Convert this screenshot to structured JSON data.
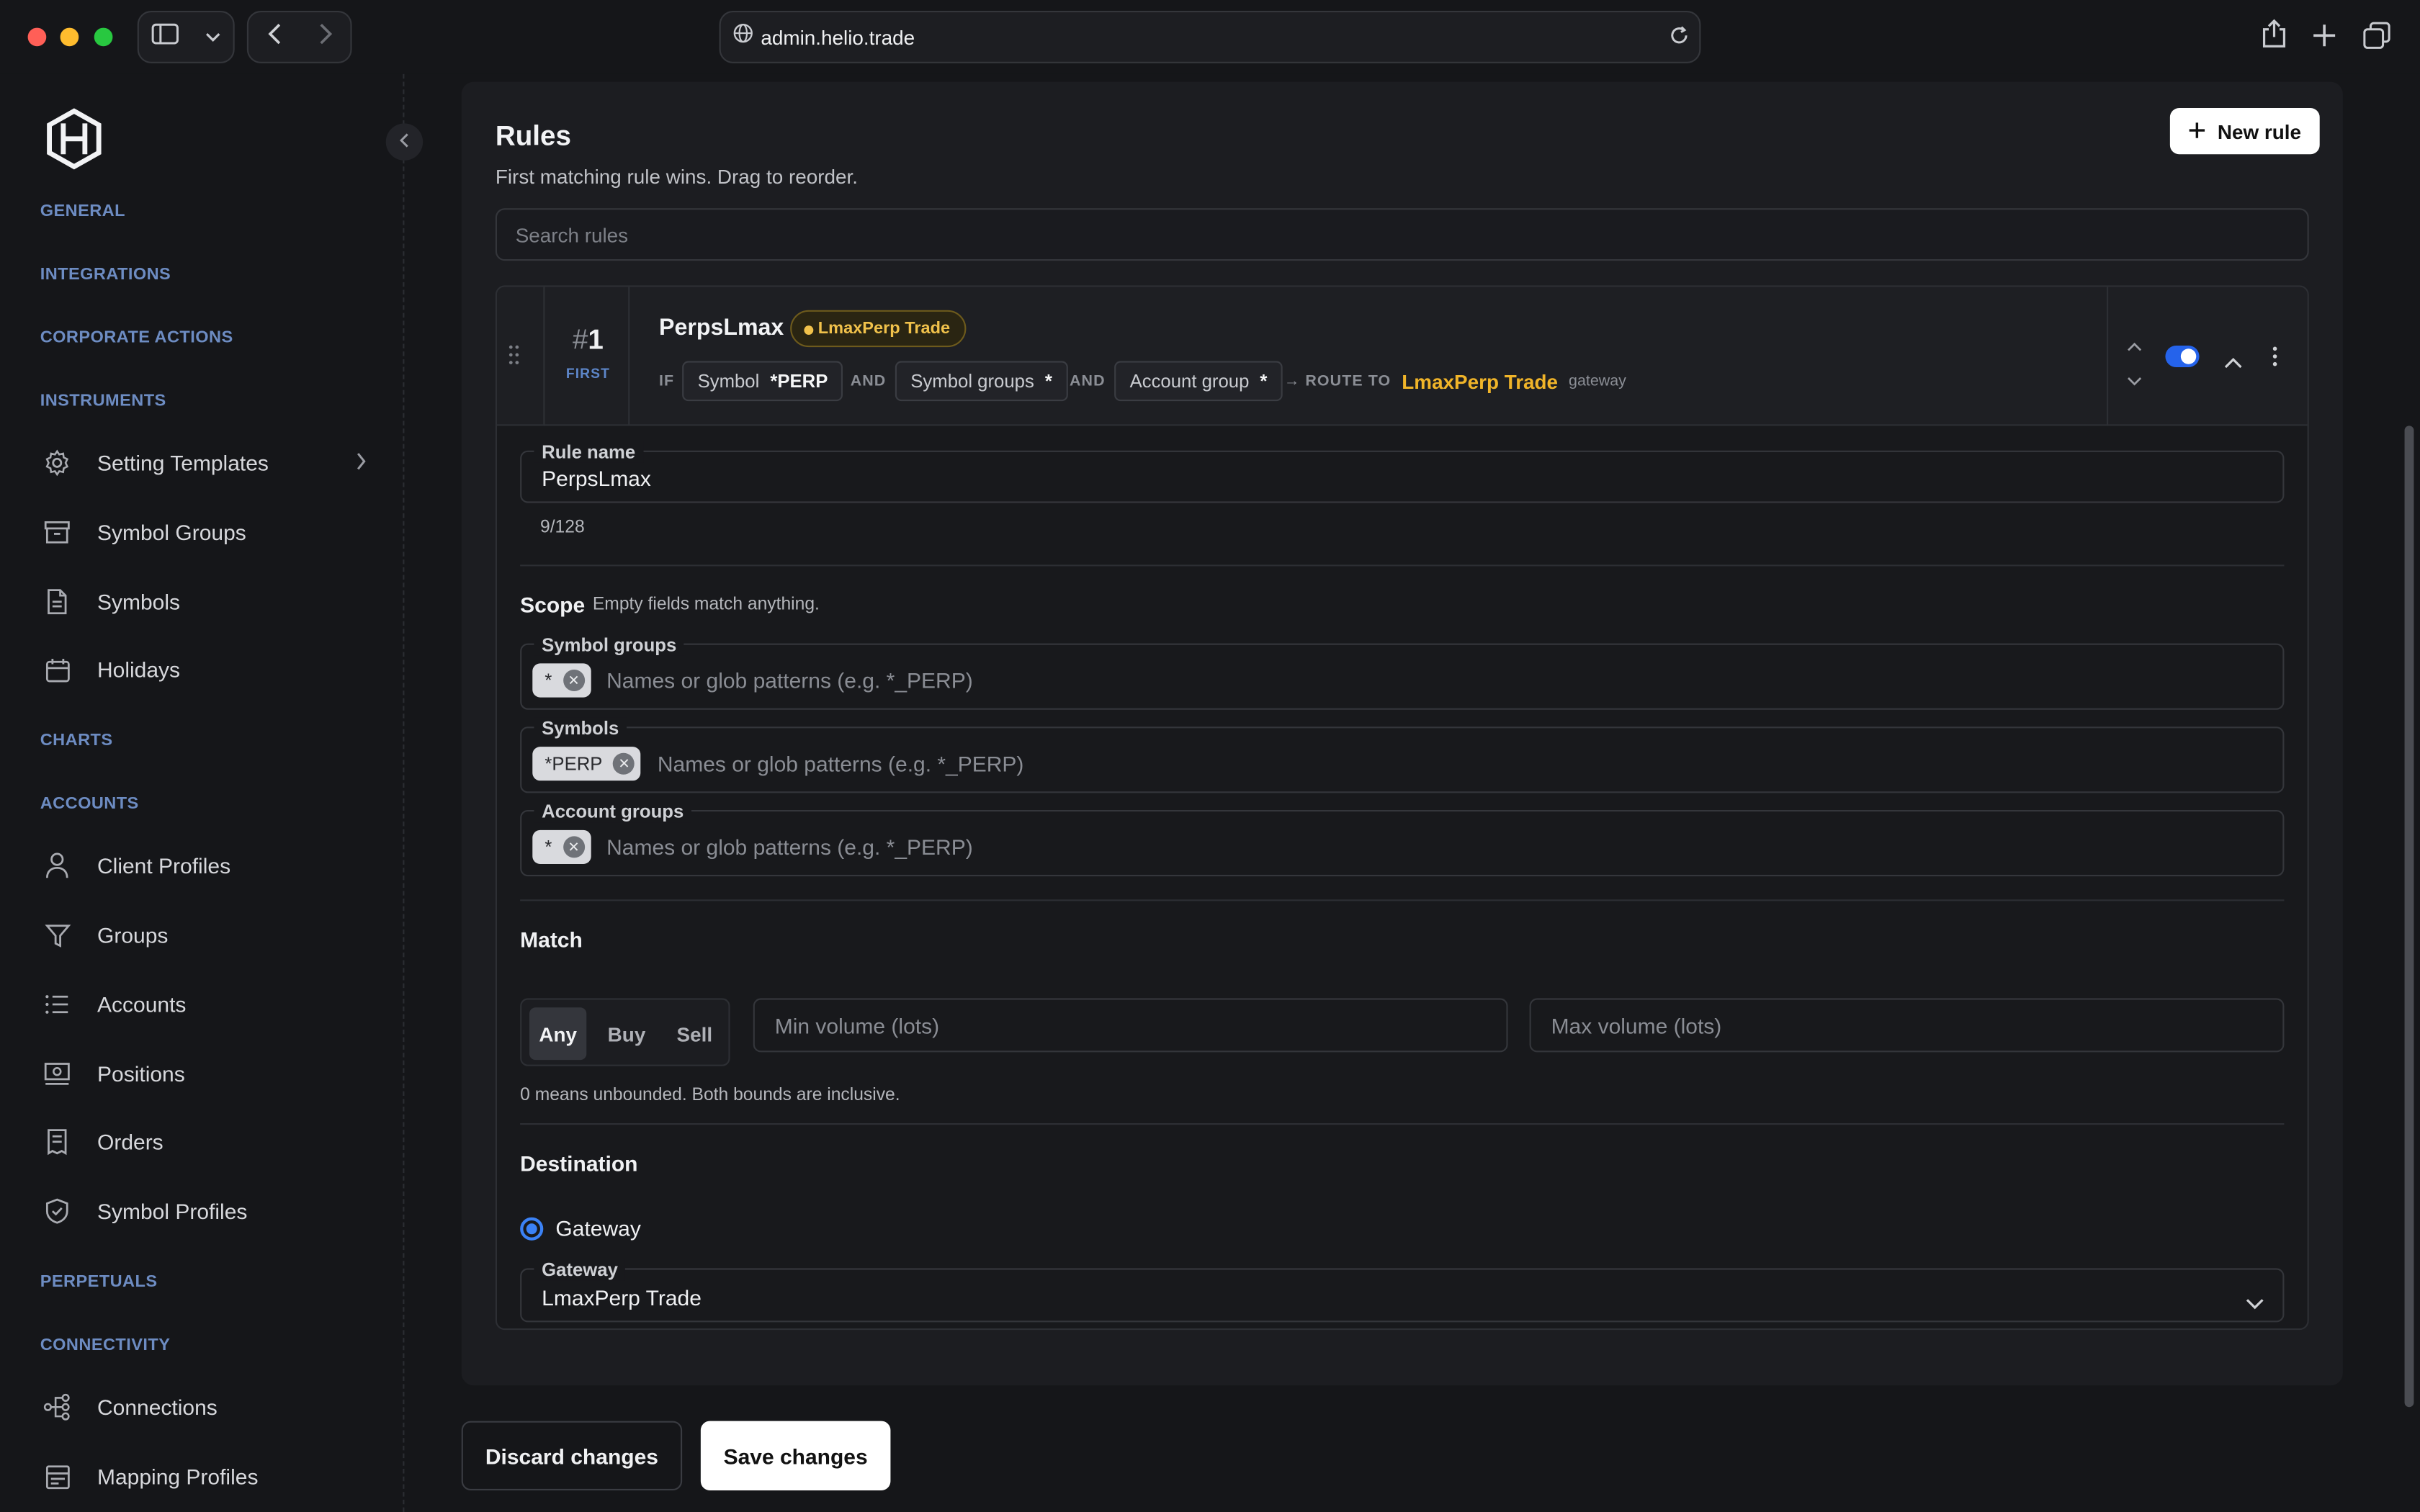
{
  "browser": {
    "url": "admin.helio.trade"
  },
  "sidebar": {
    "sections": {
      "general": "GENERAL",
      "integrations": "INTEGRATIONS",
      "corporate_actions": "CORPORATE ACTIONS",
      "instruments": "INSTRUMENTS",
      "charts": "CHARTS",
      "accounts": "ACCOUNTS",
      "perpetuals": "PERPETUALS",
      "connectivity": "CONNECTIVITY"
    },
    "items": {
      "setting_templates": {
        "label": "Setting Templates",
        "icon": "gear-icon"
      },
      "symbol_groups": {
        "label": "Symbol Groups",
        "icon": "archive-icon"
      },
      "symbols": {
        "label": "Symbols",
        "icon": "document-icon"
      },
      "holidays": {
        "label": "Holidays",
        "icon": "calendar-icon"
      },
      "client_profiles": {
        "label": "Client Profiles",
        "icon": "user-icon"
      },
      "groups": {
        "label": "Groups",
        "icon": "filter-icon"
      },
      "accounts": {
        "label": "Accounts",
        "icon": "list-icon"
      },
      "positions": {
        "label": "Positions",
        "icon": "banknote-icon"
      },
      "orders": {
        "label": "Orders",
        "icon": "receipt-icon"
      },
      "symbol_profiles": {
        "label": "Symbol Profiles",
        "icon": "shield-check-icon"
      },
      "connections": {
        "label": "Connections",
        "icon": "network-icon"
      },
      "mapping_profiles": {
        "label": "Mapping Profiles",
        "icon": "table-icon"
      }
    }
  },
  "header": {
    "title": "Rules",
    "subtitle": "First matching rule wins. Drag to reorder.",
    "new_rule": "New rule",
    "search_placeholder": "Search rules"
  },
  "rule": {
    "hash": "#",
    "rank": "1",
    "rank_label": "FIRST",
    "name": "PerpsLmax",
    "badge": "LmaxPerp Trade",
    "if": "IF",
    "and": "AND",
    "conditions": [
      {
        "key": "Symbol",
        "value": "*PERP"
      },
      {
        "key": "Symbol groups",
        "value": "*"
      },
      {
        "key": "Account group",
        "value": "*"
      }
    ],
    "route_to": "→ ROUTE TO",
    "route_name": "LmaxPerp Trade",
    "route_kind": "gateway",
    "enabled": true
  },
  "form": {
    "rule_name_label": "Rule name",
    "rule_name_value": "PerpsLmax",
    "char_count": "9/128",
    "scope_title": "Scope",
    "scope_hint": "Empty fields match anything.",
    "symbol_groups_label": "Symbol groups",
    "symbol_groups_tags": [
      "*"
    ],
    "symbols_label": "Symbols",
    "symbols_tags": [
      "*PERP"
    ],
    "account_groups_label": "Account groups",
    "account_groups_tags": [
      "*"
    ],
    "glob_placeholder": "Names or glob patterns (e.g. *_PERP)",
    "match_title": "Match",
    "side_options": [
      "Any",
      "Buy",
      "Sell"
    ],
    "side_selected": "Any",
    "min_volume_placeholder": "Min volume (lots)",
    "max_volume_placeholder": "Max volume (lots)",
    "volume_hint": "0 means unbounded. Both bounds are inclusive.",
    "destination_title": "Destination",
    "destination_option": "Gateway",
    "gateway_label": "Gateway",
    "gateway_value": "LmaxPerp Trade"
  },
  "footer": {
    "discard": "Discard changes",
    "save": "Save changes"
  },
  "colors": {
    "accent": "#2563eb",
    "route": "#f0b429",
    "section": "#6d8cc2"
  }
}
